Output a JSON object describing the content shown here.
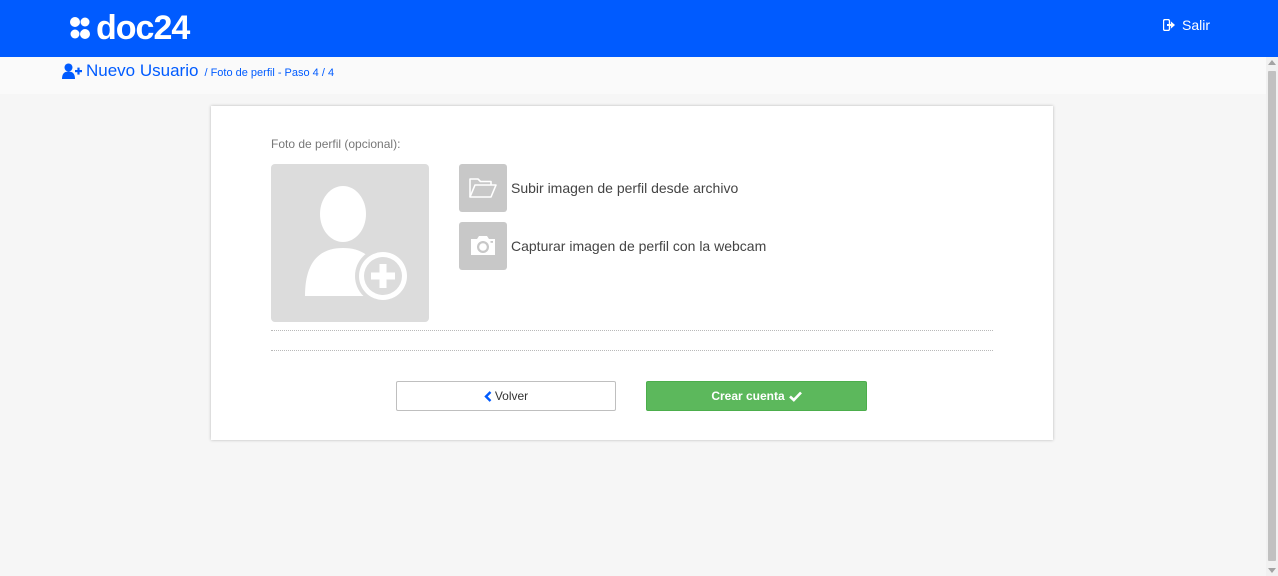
{
  "app": {
    "logo_text": "doc24",
    "logout_label": "Salir",
    "brand_color": "#005bff"
  },
  "breadcrumb": {
    "title": "Nuevo Usuario",
    "subtitle": "/ Foto de perfil - Paso 4 / 4"
  },
  "form": {
    "photo_label": "Foto de perfil (opcional):",
    "upload_label": "Subir imagen de perfil desde archivo",
    "webcam_label": "Capturar imagen de perfil con la webcam",
    "back_label": "Volver",
    "create_label": "Crear cuenta",
    "create_color": "#5cb85c"
  },
  "icons": {
    "logo": "doc24-logo-icon",
    "logout": "sign-out-icon",
    "new_user": "user-plus-icon",
    "avatar": "user-add-placeholder-icon",
    "upload": "folder-open-icon",
    "webcam": "camera-icon",
    "back": "chevron-left-icon",
    "create": "check-icon"
  }
}
